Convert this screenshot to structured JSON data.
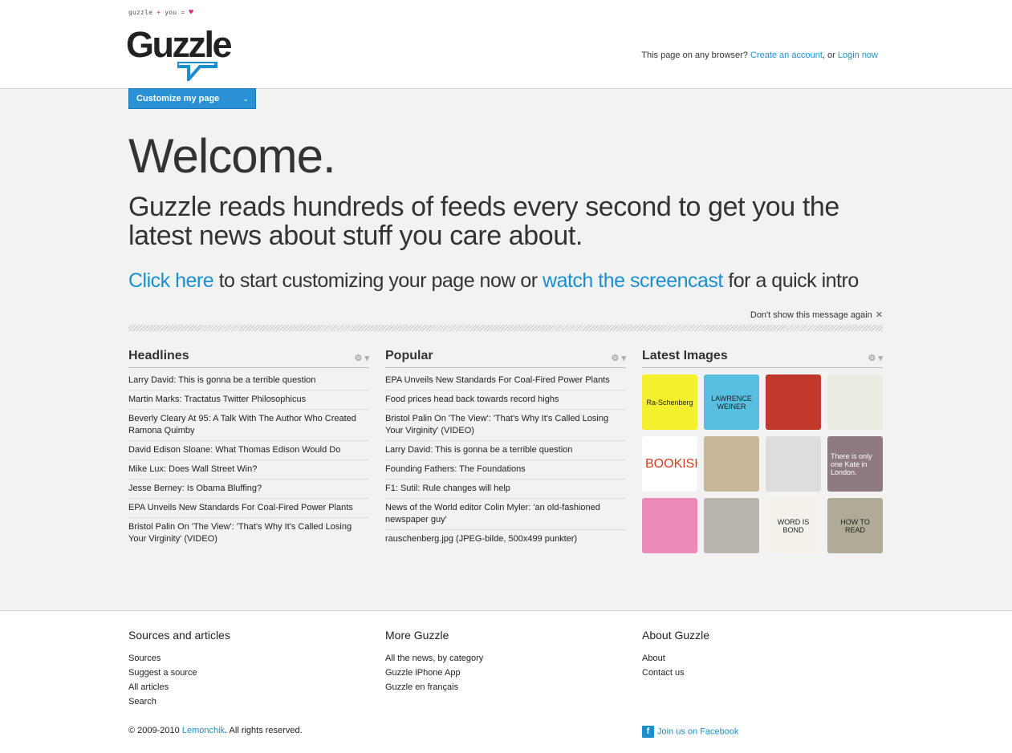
{
  "header": {
    "tagline": "guzzle + you = ♥",
    "tagline_parts": [
      "guzzle",
      "+",
      "you",
      "="
    ],
    "logo": "Guzzle",
    "account_prefix": "This page on any browser?",
    "create_account": "Create an account",
    "or_text": ", or",
    "login": "Login now"
  },
  "customize_button": "Customize my page",
  "welcome": {
    "title": "Welcome.",
    "intro": "Guzzle reads hundreds of feeds every second to get you the latest news about stuff you care about.",
    "click_here": "Click here",
    "middle_text": " to start customizing your page now or ",
    "screencast": "watch the screencast",
    "end_text": " for a quick intro",
    "dont_show": "Don't show this message again"
  },
  "headlines": {
    "title": "Headlines",
    "items": [
      "Larry David: This is gonna be a terrible question",
      "Martin Marks: Tractatus Twitter Philosophicus",
      "Beverly Cleary At 95: A Talk With The Author Who Created Ramona Quimby",
      "David Edison Sloane: What Thomas Edison Would Do",
      "Mike Lux: Does Wall Street Win?",
      "Jesse Berney: Is Obama Bluffing?",
      "EPA Unveils New Standards For Coal-Fired Power Plants",
      "Bristol Palin On 'The View': 'That's Why It's Called Losing Your Virginity' (VIDEO)"
    ]
  },
  "popular": {
    "title": "Popular",
    "items": [
      "EPA Unveils New Standards For Coal-Fired Power Plants",
      "Food prices head back towards record highs",
      "Bristol Palin On 'The View': 'That's Why It's Called Losing Your Virginity' (VIDEO)",
      "Larry David: This is gonna be a terrible question",
      "Founding Fathers: The Foundations",
      "F1: Sutil: Rule changes will help",
      "News of the World editor Colin Myler: 'an old-fashioned newspaper guy'",
      "rauschenberg.jpg (JPEG-bilde, 500x499 punkter)"
    ]
  },
  "latest_images": {
    "title": "Latest Images",
    "thumbs": [
      {
        "bg": "#f5f02e",
        "text": "Ra-Schenberg"
      },
      {
        "bg": "#58bfe0",
        "text": "LAWRENCE WEINER"
      },
      {
        "bg": "#c0392b",
        "text": ""
      },
      {
        "bg": "#ecebe4",
        "text": ""
      },
      {
        "bg": "#ffffff",
        "text": "BOOKISH"
      },
      {
        "bg": "#c9b79a",
        "text": ""
      },
      {
        "bg": "#dddddd",
        "text": ""
      },
      {
        "bg": "#8e7a80",
        "text": "There is only one Kate in London."
      },
      {
        "bg": "#e98ab8",
        "text": ""
      },
      {
        "bg": "#b9b5ad",
        "text": ""
      },
      {
        "bg": "#f4f1ea",
        "text": "WORD IS BOND"
      },
      {
        "bg": "#b0ab96",
        "text": "HOW TO READ"
      }
    ]
  },
  "footer": {
    "sources": {
      "title": "Sources and articles",
      "items": [
        "Sources",
        "Suggest a source",
        "All articles",
        "Search"
      ]
    },
    "more": {
      "title": "More Guzzle",
      "items": [
        "All the news, by category",
        "Guzzle iPhone App",
        "Guzzle en français"
      ]
    },
    "about": {
      "title": "About Guzzle",
      "items": [
        "About",
        "Contact us"
      ]
    },
    "copyright_prefix": "© 2009-2010 ",
    "company": "Lemonchik",
    "copyright_suffix": ". All rights reserved.",
    "facebook": "Join us on Facebook"
  },
  "colors": {
    "link": "#1a8fd0",
    "button": "#2a92d4",
    "heart": "#e0207a"
  }
}
